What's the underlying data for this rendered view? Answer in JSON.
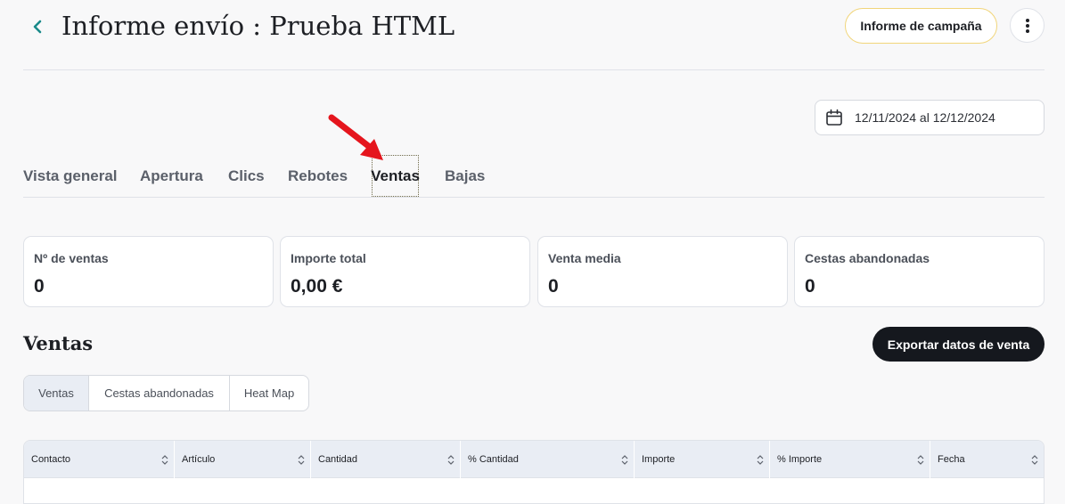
{
  "header": {
    "title": "Informe envío : Prueba HTML",
    "campaign_button": "Informe de campaña",
    "back_icon": "chevron-left-icon",
    "more_icon": "vertical-ellipsis-icon"
  },
  "date_range": {
    "value": "12/11/2024 al 12/12/2024",
    "icon": "calendar-icon"
  },
  "tabs": [
    {
      "label": "Vista general",
      "active": false
    },
    {
      "label": "Apertura",
      "active": false
    },
    {
      "label": "Clics",
      "active": false
    },
    {
      "label": "Rebotes",
      "active": false
    },
    {
      "label": "Ventas",
      "active": true
    },
    {
      "label": "Bajas",
      "active": false
    }
  ],
  "stats": [
    {
      "label": "Nº de ventas",
      "value": "0"
    },
    {
      "label": "Importe total",
      "value": "0,00 €"
    },
    {
      "label": "Venta media",
      "value": "0"
    },
    {
      "label": "Cestas abandonadas",
      "value": "0"
    }
  ],
  "sales": {
    "title": "Ventas",
    "export_button": "Exportar datos de venta",
    "views": [
      {
        "label": "Ventas",
        "active": true
      },
      {
        "label": "Cestas abandonadas",
        "active": false
      },
      {
        "label": "Heat Map",
        "active": false
      }
    ],
    "columns": [
      "Contacto",
      "Artículo",
      "Cantidad",
      "% Cantidad",
      "Importe",
      "% Importe",
      "Fecha"
    ]
  },
  "colors": {
    "accent": "#1a8a8a",
    "campaign_border": "#f1d57a",
    "arrow": "#e5151d",
    "export_bg": "#15181e"
  }
}
